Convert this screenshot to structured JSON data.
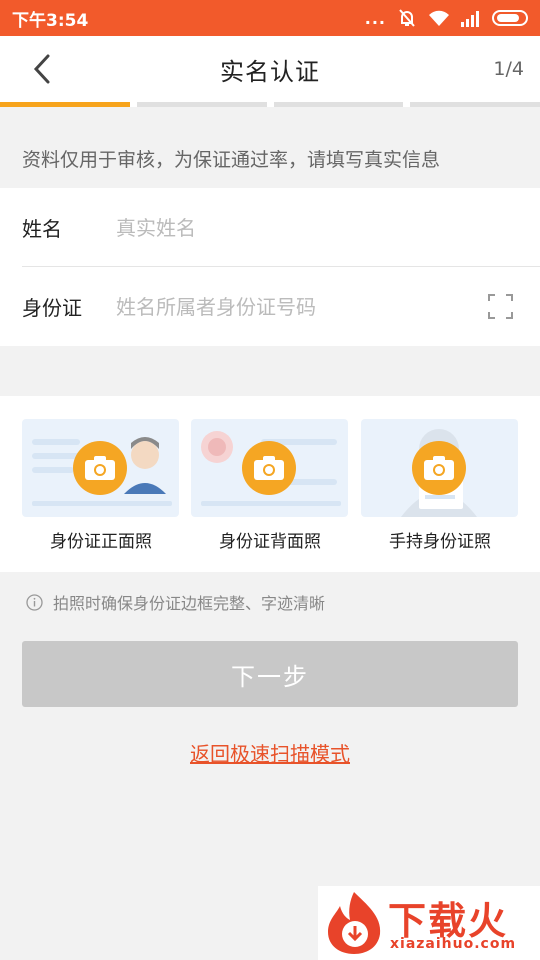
{
  "status_bar": {
    "time": "下午3:54",
    "dots": "..."
  },
  "nav": {
    "title": "实名认证",
    "step": "1/4"
  },
  "progress": {
    "total_steps": 4,
    "current_step": 1,
    "active_color": "#f7a41c"
  },
  "tip": "资料仅用于审核，为保证通过率，请填写真实信息",
  "form": {
    "name": {
      "label": "姓名",
      "placeholder": "真实姓名"
    },
    "id_number": {
      "label": "身份证",
      "placeholder": "姓名所属者身份证号码"
    }
  },
  "photos": [
    {
      "label": "身份证正面照",
      "icon": "camera-icon"
    },
    {
      "label": "身份证背面照",
      "icon": "camera-icon"
    },
    {
      "label": "手持身份证照",
      "icon": "camera-icon"
    }
  ],
  "hint": "拍照时确保身份证边框完整、字迹清晰",
  "next_button": "下一步",
  "switch_link": "返回极速扫描模式",
  "watermark": {
    "text": "下载火",
    "sub": "xiazaihuo.com"
  },
  "colors": {
    "status_bar": "#f25a2b",
    "accent": "#f5a623",
    "link": "#e8532a",
    "button_disabled": "#c8c8c8"
  }
}
